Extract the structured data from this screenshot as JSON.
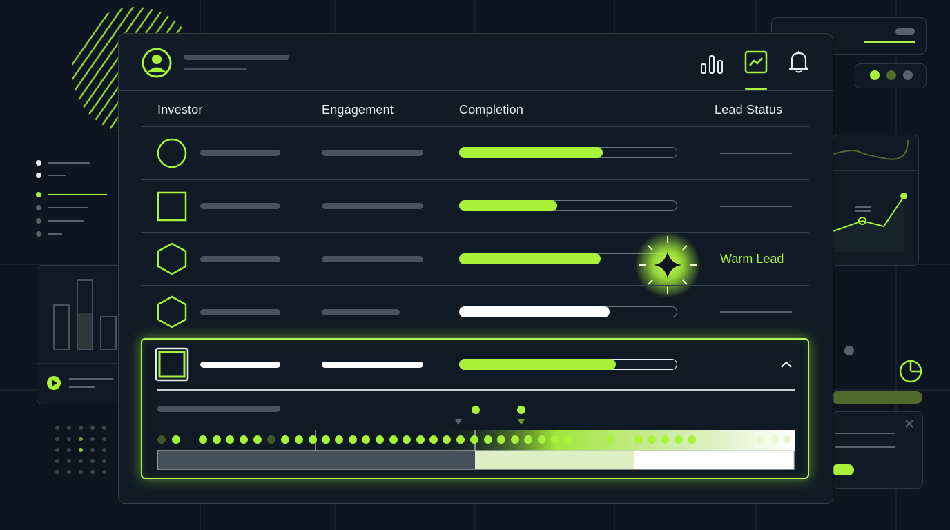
{
  "table": {
    "headers": {
      "investor": "Investor",
      "engagement": "Engagement",
      "completion": "Completion",
      "lead_status": "Lead Status"
    },
    "rows": [
      {
        "shape": "circle-icon",
        "completion": 0.66,
        "bar_color": "#a8f23a",
        "status": ""
      },
      {
        "shape": "square-icon",
        "completion": 0.45,
        "bar_color": "#a8f23a",
        "status": ""
      },
      {
        "shape": "hexagon-icon",
        "completion": 0.65,
        "bar_color": "#a8f23a",
        "status": "Warm Lead"
      },
      {
        "shape": "hexagon-icon",
        "completion": 0.69,
        "bar_color": "#ffffff",
        "status": ""
      },
      {
        "shape": "square-icon",
        "completion": 0.72,
        "bar_color": "#a8f23a",
        "status": "",
        "expanded": true
      }
    ]
  },
  "header_icons": [
    "bar-chart-icon",
    "line-chart-icon",
    "bell-icon"
  ],
  "colors": {
    "accent": "#a8f23a",
    "background": "#0d1620",
    "panel": "#101b25",
    "border": "#34424d"
  }
}
